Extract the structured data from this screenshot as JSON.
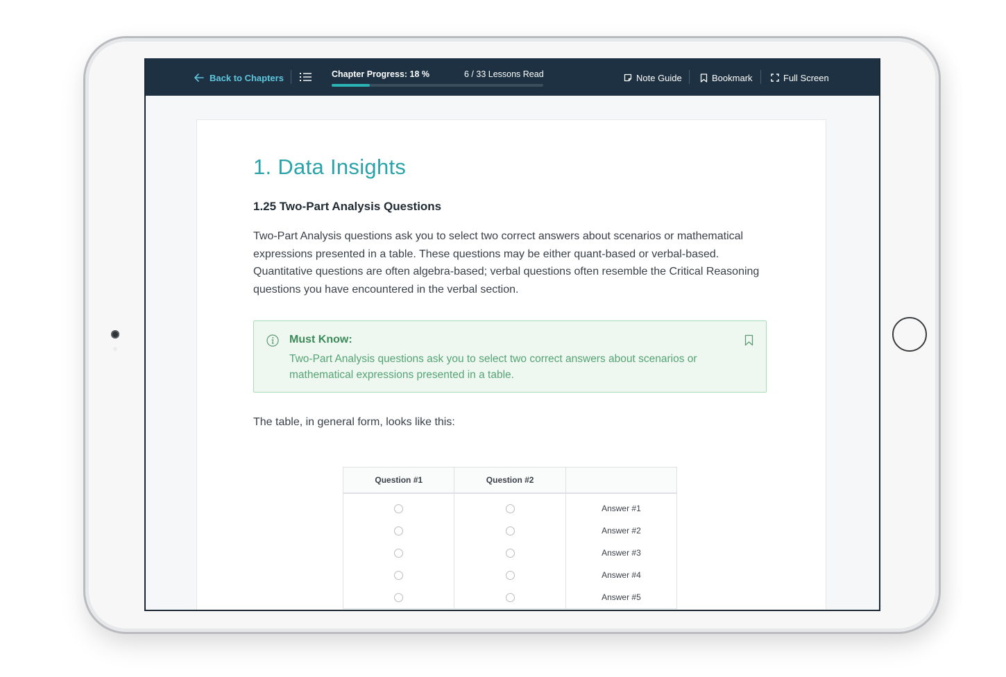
{
  "topbar": {
    "back_label": "Back to Chapters",
    "progress_label": "Chapter Progress: 18 %",
    "progress_percent": 18,
    "lessons_read": "6 / 33 Lessons Read",
    "tools": {
      "note_guide": "Note Guide",
      "bookmark": "Bookmark",
      "full_screen": "Full Screen"
    }
  },
  "lesson": {
    "chapter_title": "1. Data Insights",
    "section_title": "1.25 Two-Part Analysis Questions",
    "body": "Two-Part Analysis questions ask you to select two correct answers about scenarios or mathematical expressions presented in a table. These questions may be either quant-based or verbal-based. Quantitative questions are often algebra-based; verbal questions often resemble the Critical Reasoning questions you have encountered in the verbal section.",
    "must_know": {
      "title": "Must Know:",
      "text": "Two-Part Analysis questions ask you to select two correct answers about scenarios or mathematical expressions presented in a table."
    },
    "intro_line": "The table, in general form, looks like this:"
  },
  "table": {
    "headers": [
      "Question #1",
      "Question #2",
      ""
    ],
    "answers": [
      "Answer #1",
      "Answer #2",
      "Answer #3",
      "Answer #4",
      "Answer #5"
    ]
  },
  "colors": {
    "topbar_bg": "#1d3142",
    "accent_link": "#5fc6dd",
    "title_teal": "#2aa3aa",
    "must_know_bg": "#eef8f1",
    "must_know_text": "#55a374"
  }
}
